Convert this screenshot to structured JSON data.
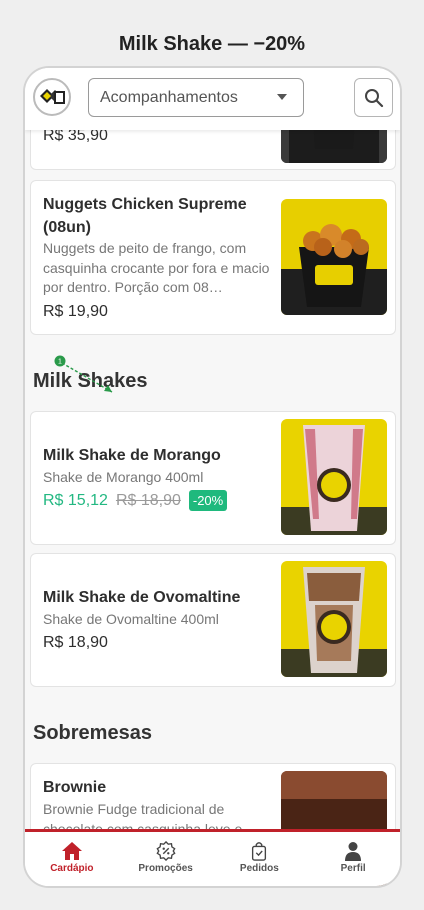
{
  "page_title": "Milk Shake — −20%",
  "header": {
    "category_selected": "Acompanhamentos"
  },
  "products_top": [
    {
      "price": "R$ 35,90"
    },
    {
      "name": "Nuggets Chicken Supreme (08un)",
      "description": "Nuggets de peito de frango, com casquinha crocante por fora e macio por dentro. Porção com 08…",
      "price": "R$ 19,90"
    }
  ],
  "sections": {
    "milk_shakes": {
      "title": "Milk Shakes",
      "items": [
        {
          "name": "Milk Shake de Morango",
          "description": "Shake de Morango 400ml",
          "promo_price": "R$ 15,12",
          "old_price": "R$ 18,90",
          "discount": "-20%"
        },
        {
          "name": "Milk Shake de Ovomaltine",
          "description": "Shake de Ovomaltine 400ml",
          "price": "R$ 18,90"
        }
      ]
    },
    "sobremesas": {
      "title": "Sobremesas",
      "items": [
        {
          "name": "Brownie",
          "description": "Brownie Fudge tradicional de chocolate com casquinha leve e"
        }
      ]
    }
  },
  "annotation": {
    "marker": "1"
  },
  "bottom_nav": [
    {
      "label": "Cardápio",
      "icon": "home-icon",
      "active": true
    },
    {
      "label": "Promoções",
      "icon": "percent-badge-icon",
      "active": false
    },
    {
      "label": "Pedidos",
      "icon": "shopping-bag-icon",
      "active": false
    },
    {
      "label": "Perfil",
      "icon": "person-icon",
      "active": false
    }
  ],
  "colors": {
    "brand": "#c0212a",
    "promo": "#1fb97d",
    "shake_bg": "#e9d300"
  }
}
